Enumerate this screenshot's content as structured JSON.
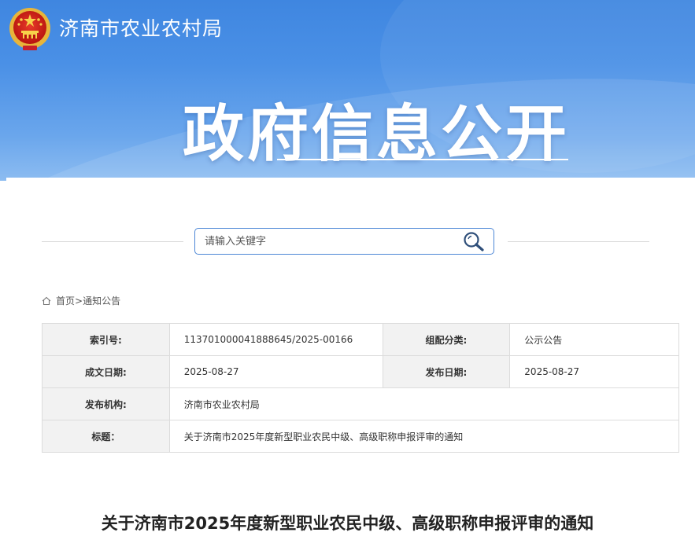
{
  "header": {
    "site_name": "济南市农业农村局",
    "banner_title": "政府信息公开"
  },
  "search": {
    "placeholder": "请输入关键字",
    "value": ""
  },
  "breadcrumb": {
    "home": "首页",
    "separator": ">",
    "current": "通知公告"
  },
  "meta": {
    "index_label": "索引号:",
    "index_value": "113701000041888645/2025-00166",
    "category_label": "组配分类:",
    "category_value": "公示公告",
    "date_label": "成文日期:",
    "date_value": "2025-08-27",
    "publish_label": "发布日期:",
    "publish_value": "2025-08-27",
    "org_label": "发布机构:",
    "org_value": "济南市农业农村局",
    "title_label": "标题：",
    "title_value": "关于济南市2025年度新型职业农民中级、高级职称申报评审的通知"
  },
  "article": {
    "title": "关于济南市2025年度新型职业农民中级、高级职称申报评审的通知"
  },
  "colors": {
    "banner_blue": "#4a90e6",
    "search_border": "#4d87d6",
    "table_label_bg": "#f2f2f2"
  },
  "icons": {
    "emblem": "national-emblem-icon",
    "search": "magnifier-icon",
    "home": "home-icon"
  }
}
